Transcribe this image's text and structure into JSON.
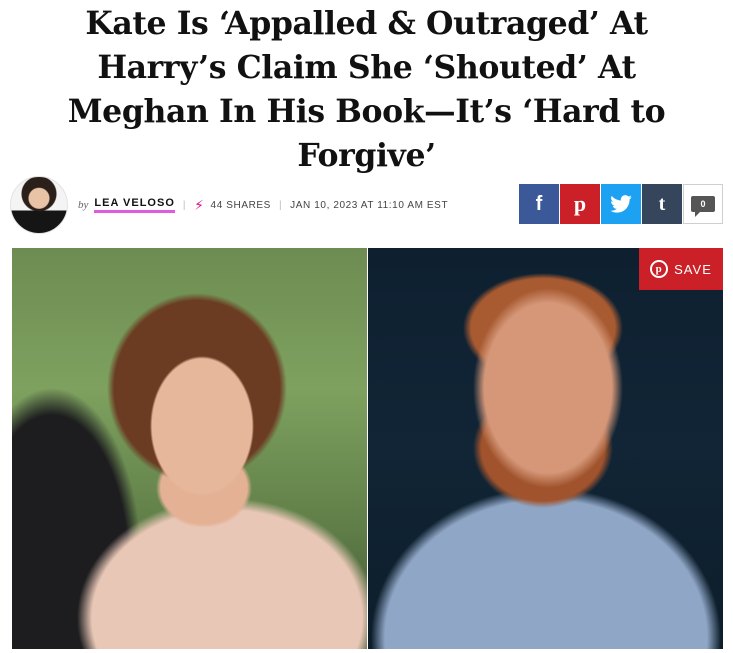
{
  "article": {
    "headline": "Kate Is ‘Appalled & Outraged’ At Harry’s Claim She ‘Shouted’ At Meghan In His Book—It’s ‘Hard to Forgive’"
  },
  "byline": {
    "by_label": "by",
    "author": "LEA VELOSO",
    "shares": "44 SHARES",
    "date": "JAN 10, 2023 AT 11:10 AM EST"
  },
  "social": {
    "facebook": "f",
    "pinterest": "p",
    "tumblr": "t",
    "comments_count": "0"
  },
  "hero": {
    "save_label": "SAVE",
    "save_icon_letter": "p"
  },
  "icons": {
    "shares": "bolt-icon",
    "facebook": "facebook-icon",
    "pinterest": "pinterest-icon",
    "twitter": "twitter-bird-icon",
    "tumblr": "tumblr-icon",
    "comments": "comment-bubble-icon"
  },
  "colors": {
    "facebook": "#3b5998",
    "pinterest": "#cb2027",
    "twitter": "#1da1f2",
    "tumblr": "#35465c",
    "author_underline": "#e05be0",
    "bolt": "#e0148c"
  }
}
